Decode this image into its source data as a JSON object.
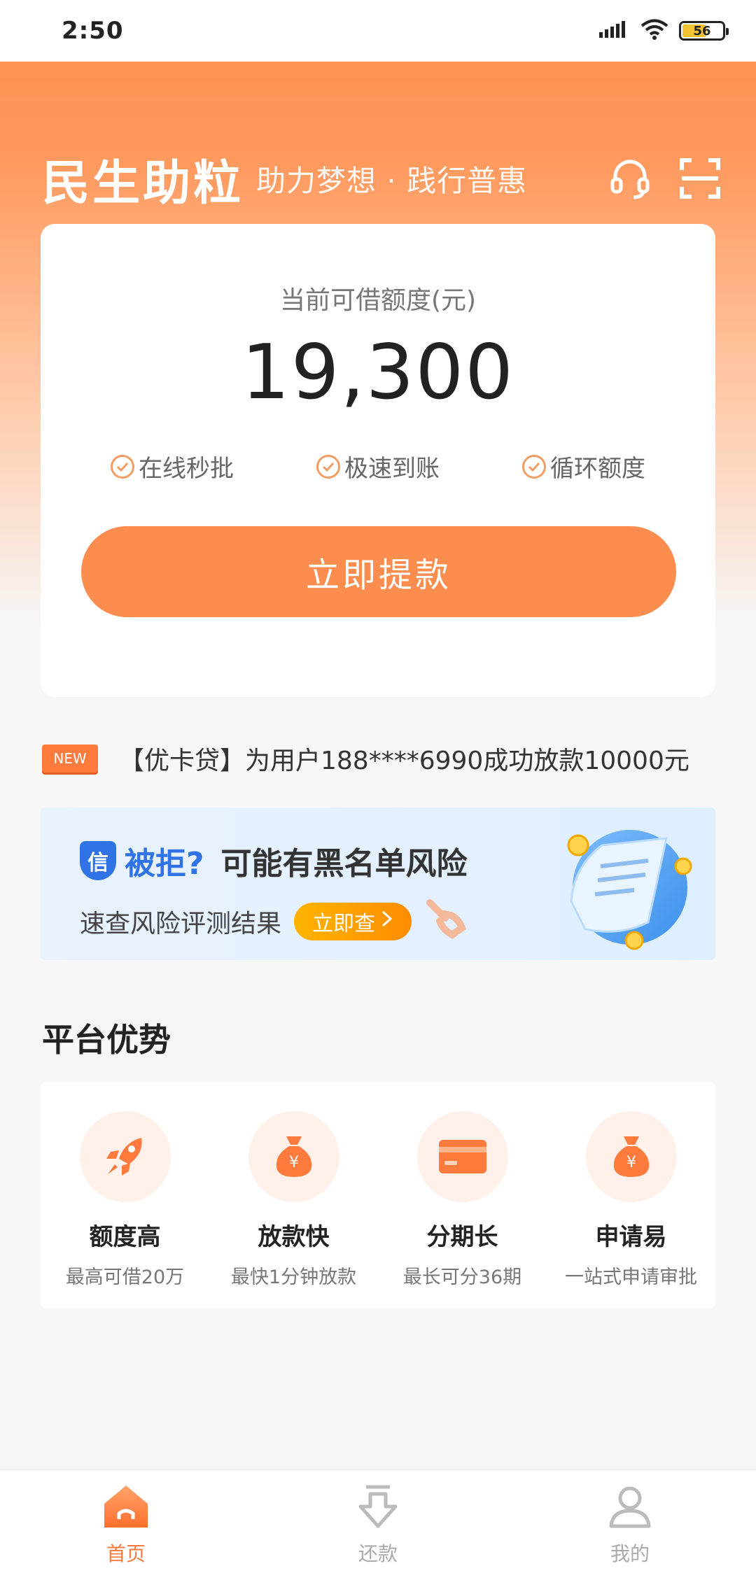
{
  "status_bar": {
    "time": "2:50",
    "battery": "56"
  },
  "header": {
    "app_name": "民生助粒",
    "slogan": "助力梦想 · 践行普惠",
    "icons": [
      "headset-icon",
      "scan-icon"
    ]
  },
  "credit_card": {
    "label": "当前可借额度(元)",
    "amount": "19,300",
    "features": [
      "在线秒批",
      "极速到账",
      "循环额度"
    ],
    "button_label": "立即提款"
  },
  "news": {
    "badge": "NEW",
    "text": "【优卡贷】为用户188****6990成功放款10000元"
  },
  "banner": {
    "shield_char": "信",
    "title_q": "被拒?",
    "title_main": "可能有黑名单风险",
    "subtitle": "速查风险评测结果",
    "button_label": "立即查"
  },
  "advantages": {
    "title": "平台优势",
    "items": [
      {
        "title": "额度高",
        "desc": "最高可借20万",
        "icon": "rocket-icon"
      },
      {
        "title": "放款快",
        "desc": "最快1分钟放款",
        "icon": "money-bag-icon"
      },
      {
        "title": "分期长",
        "desc": "最长可分36期",
        "icon": "card-icon"
      },
      {
        "title": "申请易",
        "desc": "一站式申请审批",
        "icon": "money-bag-icon"
      }
    ]
  },
  "tabbar": {
    "items": [
      {
        "label": "首页",
        "icon": "home-icon",
        "active": true
      },
      {
        "label": "还款",
        "icon": "repay-icon",
        "active": false
      },
      {
        "label": "我的",
        "icon": "user-icon",
        "active": false
      }
    ]
  },
  "colors": {
    "accent": "#fd8d4e",
    "blue": "#2f73e6"
  }
}
